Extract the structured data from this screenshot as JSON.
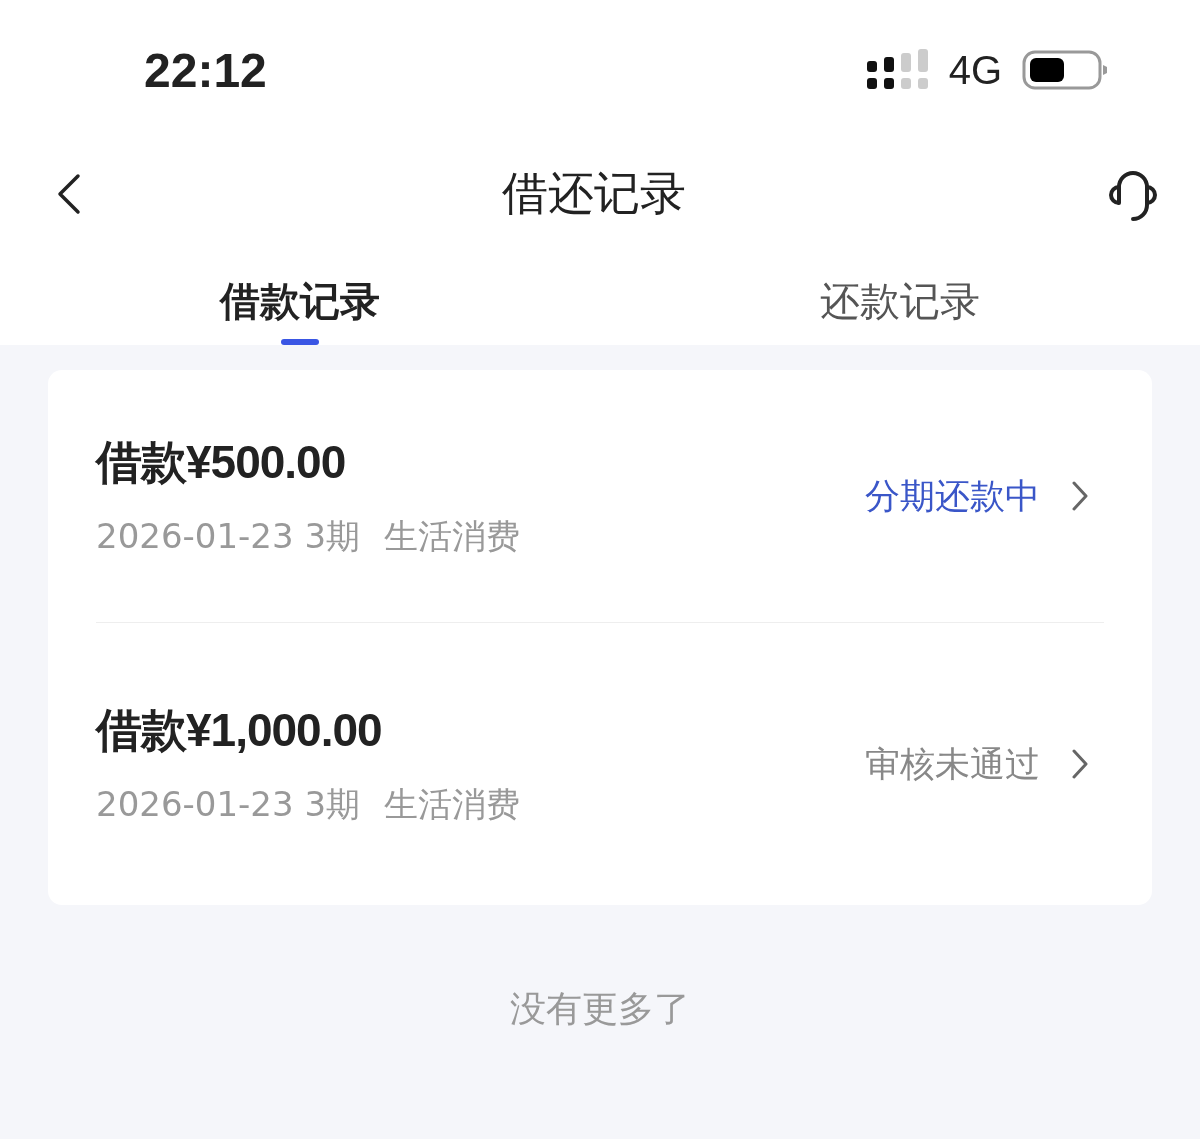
{
  "status_bar": {
    "time": "22:12",
    "network": "4G"
  },
  "header": {
    "title": "借还记录"
  },
  "tabs": [
    {
      "label": "借款记录",
      "selected": true
    },
    {
      "label": "还款记录",
      "selected": false
    }
  ],
  "records": [
    {
      "amount": "借款¥500.00",
      "date": "2026-01-23",
      "term": "3期",
      "purpose": "生活消费",
      "status": "分期还款中",
      "kind": "active"
    },
    {
      "amount": "借款¥1,000.00",
      "date": "2026-01-23",
      "term": "3期",
      "purpose": "生活消费",
      "status": "审核未通过",
      "kind": "rejected"
    }
  ],
  "footer": "没有更多了"
}
